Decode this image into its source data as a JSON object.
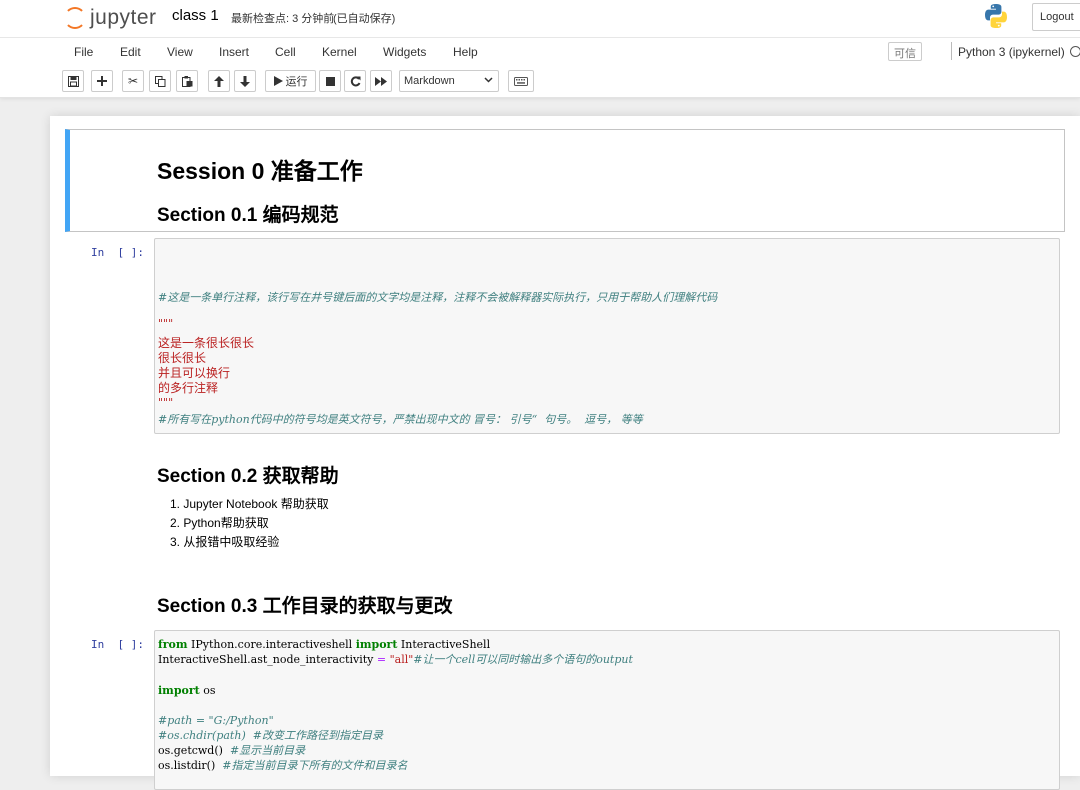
{
  "header": {
    "logo_text": "jupyter",
    "notebook_title": "class 1",
    "checkpoint": "最新检查点: 3 分钟前",
    "autosave": "(已自动保存)",
    "logout_label": "Logout"
  },
  "menubar": {
    "items": [
      "File",
      "Edit",
      "View",
      "Insert",
      "Cell",
      "Kernel",
      "Widgets",
      "Help"
    ],
    "trusted_label": "可信",
    "kernel_name": "Python 3 (ipykernel)"
  },
  "toolbar": {
    "run_label": "运行",
    "cell_type": "Markdown"
  },
  "cells": {
    "md1": {
      "h1": "Session 0 准备工作",
      "h2": "Section 0.1 编码规范"
    },
    "code1": {
      "prompt": "In  [ ]:",
      "lines": [
        "#这是一条单行注释，该行写在井号键后面的文字均是注释，注释不会被解释器实际执行，只用于帮助人们理解代码",
        "\"\"\"",
        "这是一条很长很长",
        "很长很长",
        "并且可以换行",
        "的多行注释",
        "\"\"\"",
        "#所有写在python代码中的符号均是英文符号，严禁出现中文的 冒号： 引号“  句号。  逗号， 等等"
      ]
    },
    "md2": {
      "h2": "Section 0.2 获取帮助",
      "items": [
        "1. Jupyter Notebook 帮助获取",
        "2. Python帮助获取",
        "3. 从报错中吸取经验"
      ]
    },
    "md3": {
      "h2": "Section 0.3 工作目录的获取与更改"
    },
    "code2": {
      "prompt": "In  [ ]:",
      "l1_kw1": "from",
      "l1_mod": " IPython.core.interactiveshell ",
      "l1_kw2": "import",
      "l1_name": " InteractiveShell",
      "l2_code": "InteractiveShell.ast_node_interactivity ",
      "l2_op": "=",
      "l2_str": " \"all\"",
      "l2_comment": "#让一个cell可以同时输出多个语句的output",
      "l3_kw": "import",
      "l3_name": " os",
      "l4_comment": "#path = \"G:/Python\"",
      "l5_comment": "#os.chdir(path)  #改变工作路径到指定目录",
      "l6_code": "os.getcwd()  ",
      "l6_comment": "#显示当前目录",
      "l7_code": "os.listdir()  ",
      "l7_comment": "#指定当前目录下所有的文件和目录名"
    }
  },
  "colors": {
    "accent_selected": "#42a5f5",
    "logo_orange": "#f37726",
    "prompt_blue": "#303f9f",
    "comment": "#408080",
    "string": "#ba2121",
    "keyword": "#008000"
  },
  "icons": [
    "python-logo-icon",
    "save-icon",
    "plus-icon",
    "cut-icon",
    "copy-icon",
    "paste-icon",
    "arrow-up-icon",
    "arrow-down-icon",
    "run-icon",
    "stop-icon",
    "restart-icon",
    "fast-forward-icon",
    "keyboard-icon",
    "kernel-idle-icon"
  ]
}
